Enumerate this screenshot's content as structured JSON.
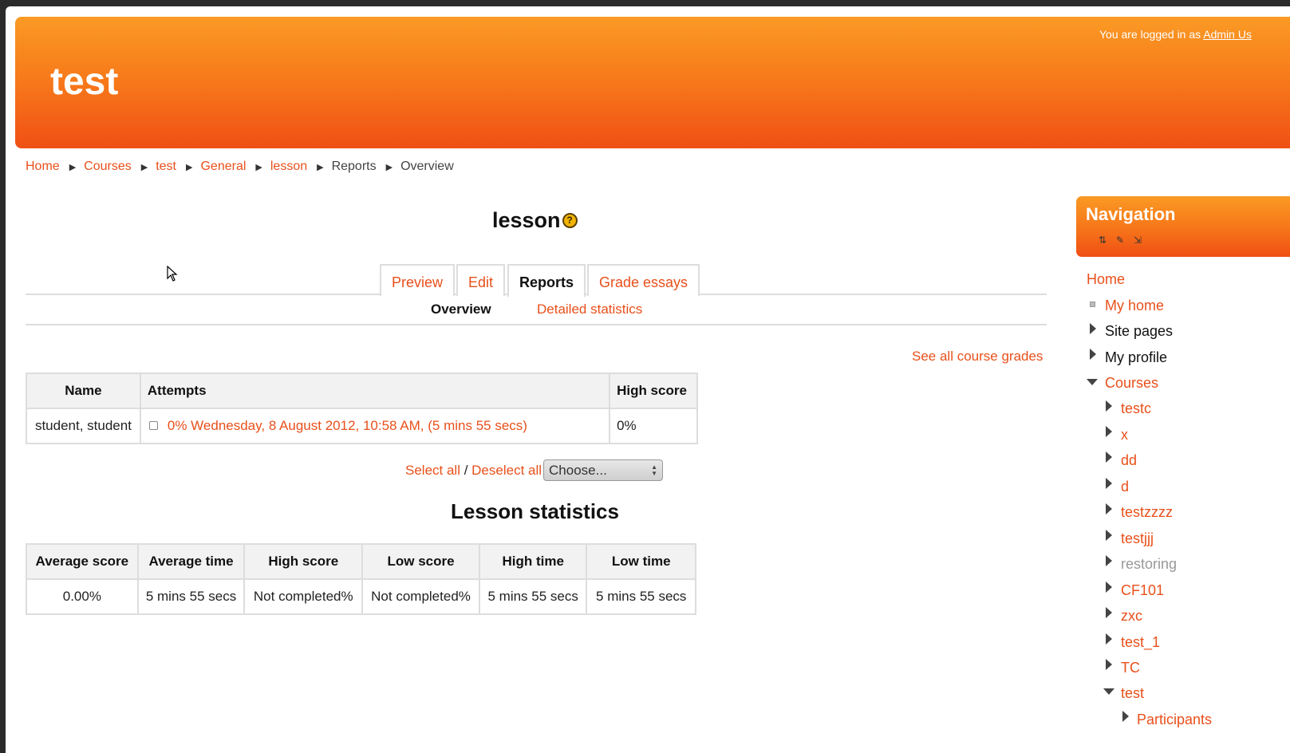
{
  "header": {
    "site_title": "test",
    "login_prefix": "You are logged in as ",
    "login_user": "Admin Us"
  },
  "breadcrumb": [
    "Home",
    "Courses",
    "test",
    "General",
    "lesson",
    "Reports",
    "Overview"
  ],
  "page": {
    "title": "lesson",
    "help_glyph": "?"
  },
  "tabs": [
    "Preview",
    "Edit",
    "Reports",
    "Grade essays"
  ],
  "subtabs": [
    "Overview",
    "Detailed statistics"
  ],
  "see_all_grades": "See all course grades",
  "grades_table": {
    "headers": [
      "Name",
      "Attempts",
      "High score"
    ],
    "rows": [
      {
        "name": "student, student",
        "attempt": "0% Wednesday, 8 August 2012, 10:58 AM, (5 mins 55 secs)",
        "high_score": "0%"
      }
    ]
  },
  "selection": {
    "select_all": "Select all",
    "separator": " / ",
    "deselect_all": "Deselect all",
    "choose": "Choose..."
  },
  "stats": {
    "title": "Lesson statistics",
    "headers": [
      "Average score",
      "Average time",
      "High score",
      "Low score",
      "High time",
      "Low time"
    ],
    "values": [
      "0.00%",
      "5 mins 55 secs",
      "Not completed%",
      "Not completed%",
      "5 mins 55 secs",
      "5 mins 55 secs"
    ]
  },
  "navigation": {
    "title": "Navigation",
    "items": {
      "home": "Home",
      "my_home": "My home",
      "site_pages": "Site pages",
      "my_profile": "My profile",
      "courses": "Courses",
      "course_list": [
        "testc",
        "x",
        "dd",
        "d",
        "testzzzz",
        "testjjj",
        "restoring",
        "CF101",
        "zxc",
        "test_1",
        "TC",
        "test"
      ],
      "participants": "Participants"
    }
  },
  "colors": {
    "accent": "#e8501b",
    "header_top": "#fa9a24",
    "header_bottom": "#f04f15"
  },
  "icons": [
    "help-icon",
    "move-icon",
    "edit-icon",
    "dock-icon",
    "expand-arrow-icon",
    "collapse-arrow-icon",
    "mouse-cursor-icon"
  ]
}
